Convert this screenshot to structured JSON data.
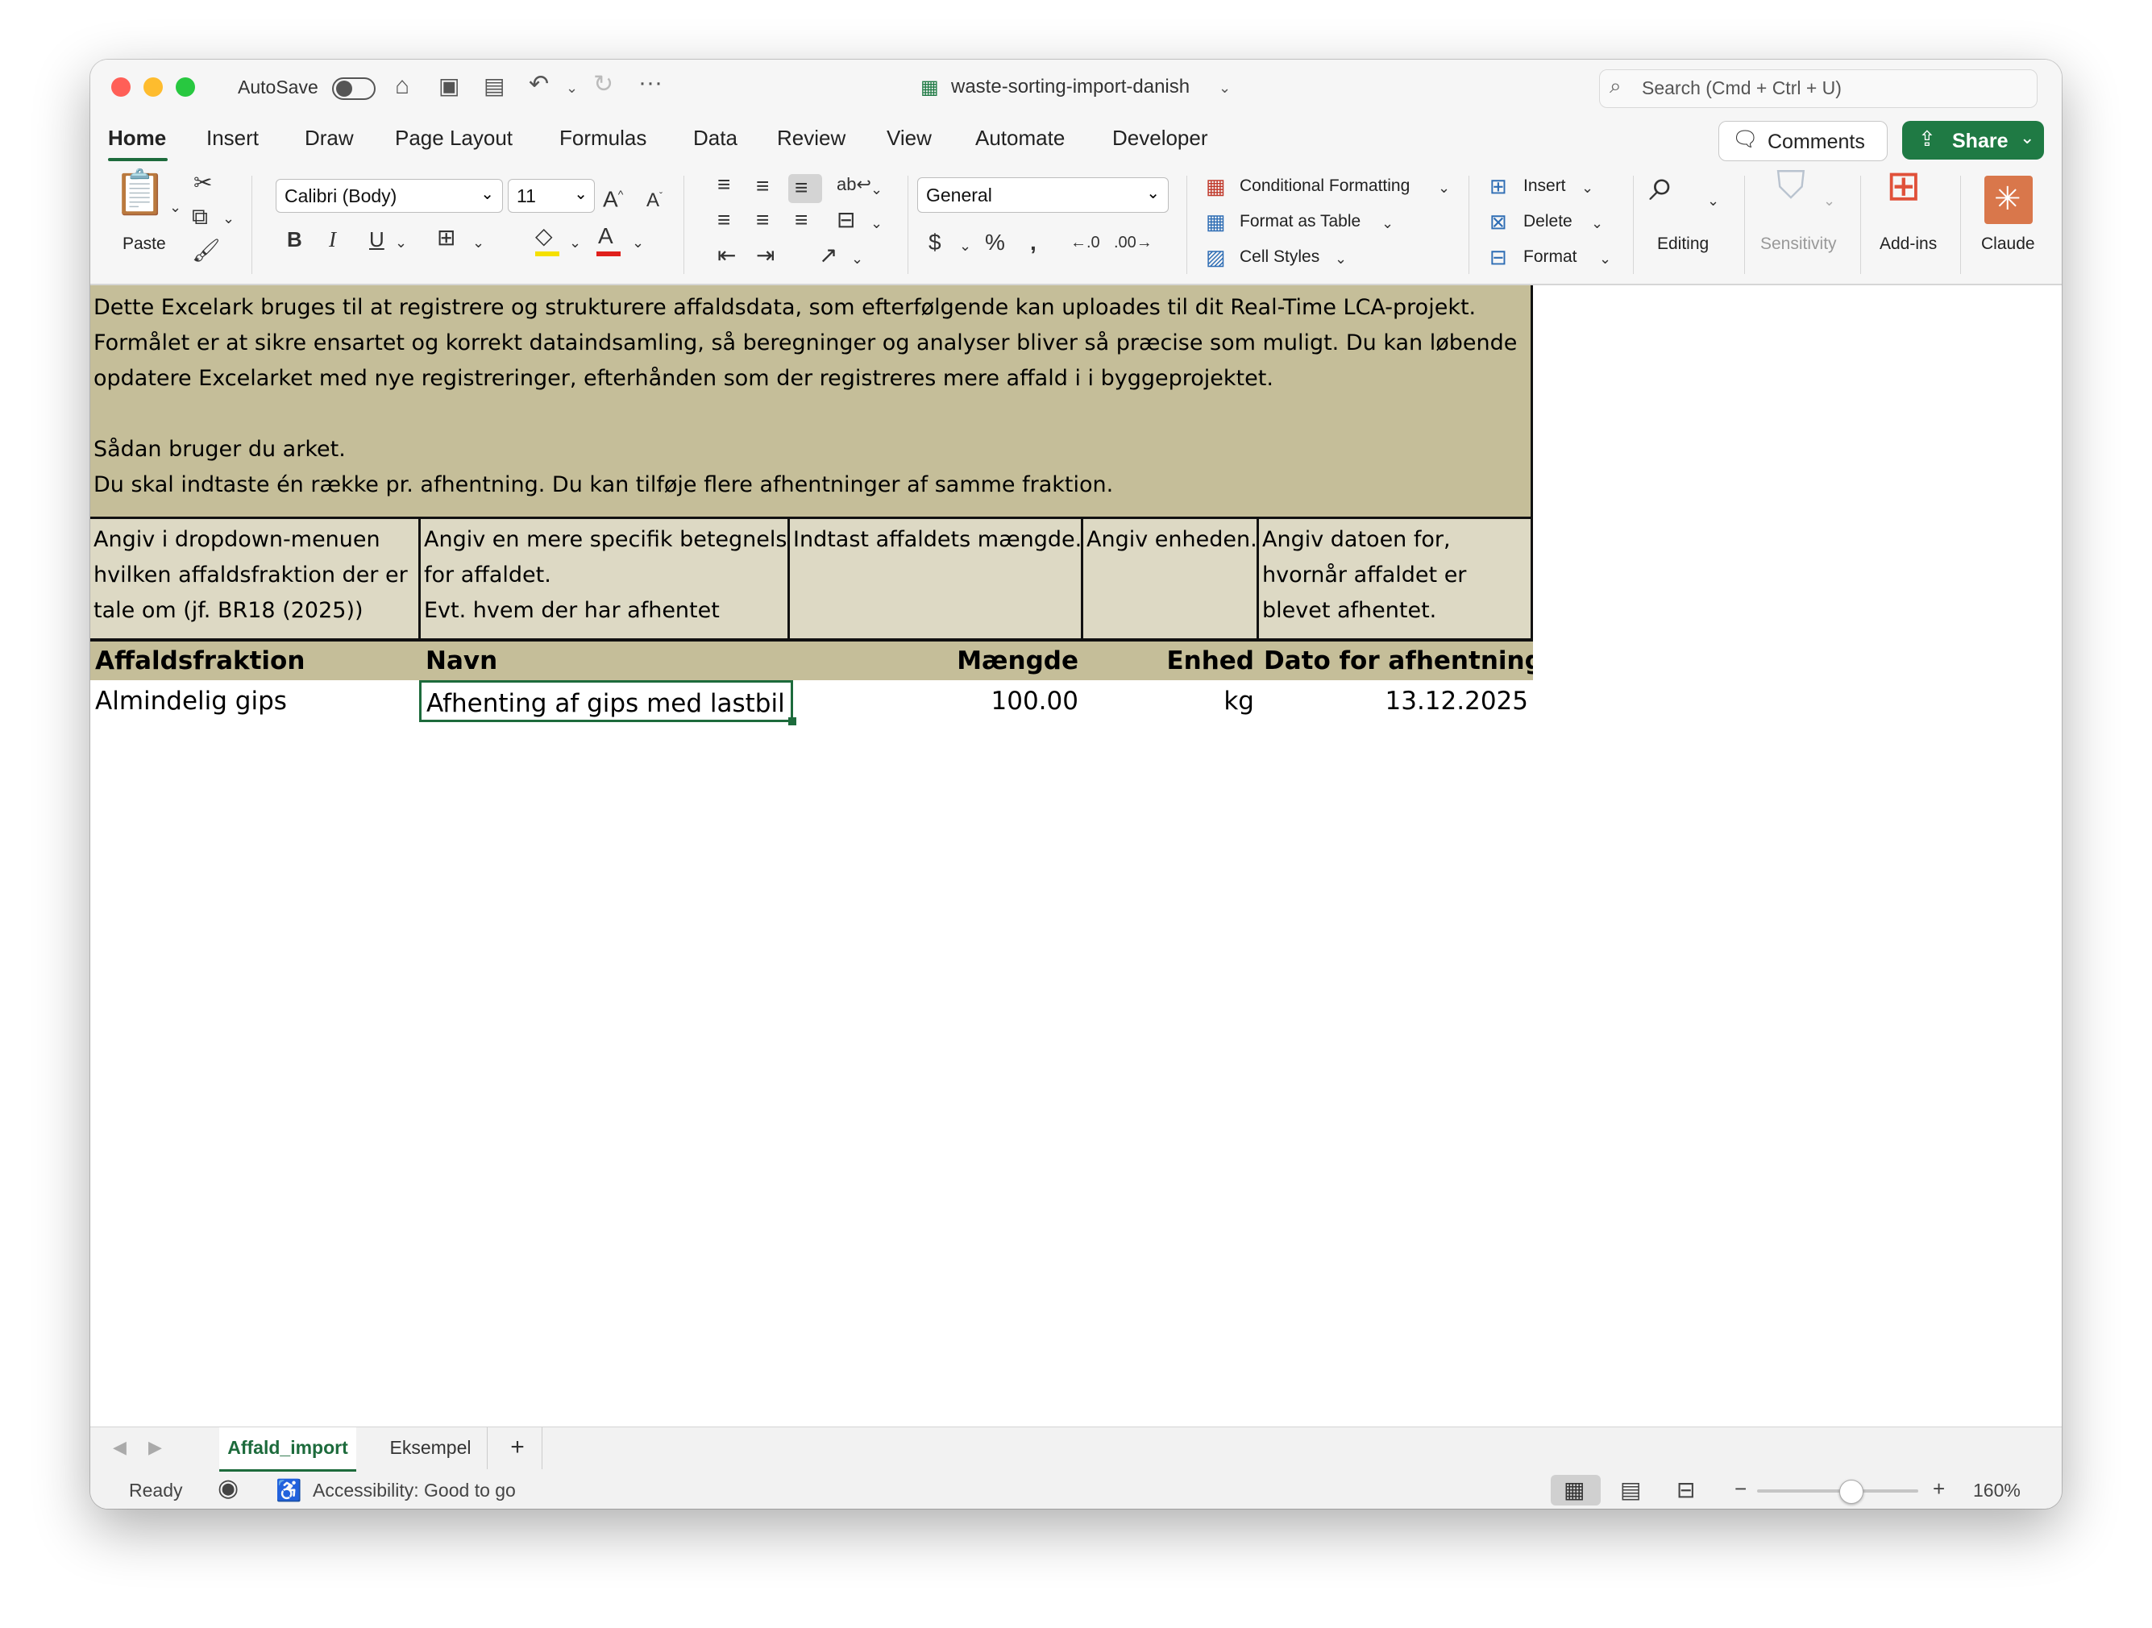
{
  "window": {
    "autosave_label": "AutoSave",
    "file_name": "waste-sorting-import-danish",
    "search_placeholder": "Search (Cmd + Ctrl + U)"
  },
  "tabs": [
    "Home",
    "Insert",
    "Draw",
    "Page Layout",
    "Formulas",
    "Data",
    "Review",
    "View",
    "Automate",
    "Developer"
  ],
  "active_tab": "Home",
  "actions": {
    "comments": "Comments",
    "share": "Share"
  },
  "ribbon": {
    "paste": "Paste",
    "font_name": "Calibri (Body)",
    "font_size": "11",
    "number_format": "General",
    "conditional_formatting": "Conditional Formatting",
    "format_as_table": "Format as Table",
    "cell_styles": "Cell Styles",
    "insert": "Insert",
    "delete": "Delete",
    "format": "Format",
    "editing": "Editing",
    "sensitivity": "Sensitivity",
    "addins": "Add-ins",
    "claude": "Claude",
    "bold": "B",
    "italic": "I",
    "underline": "U"
  },
  "sheet": {
    "intro_lines": [
      "Dette Excelark bruges til at registrere og strukturere affaldsdata, som efterfølgende kan uploades til dit Real-Time LCA-projekt.",
      "Formålet er at sikre ensartet og korrekt dataindsamling, så beregninger og analyser bliver så præcise som muligt. Du kan løbende",
      "opdatere Excelarket med nye registreringer, efterhånden som der registreres mere affald i i byggeprojektet.",
      "",
      "Sådan bruger du arket.",
      "Du skal indtaste én række pr. afhentning. Du kan tilføje flere afhentninger af samme fraktion."
    ],
    "instructions": [
      [
        "Angiv i dropdown-menuen",
        "hvilken affaldsfraktion der er",
        "tale om (jf. BR18 (2025))"
      ],
      [
        "Angiv en mere specifik betegnelse",
        "for affaldet.",
        "Evt. hvem der har afhentet"
      ],
      [
        "Indtast affaldets mængde."
      ],
      [
        "Angiv enheden."
      ],
      [
        "Angiv datoen for,",
        "hvornår affaldet er",
        "blevet afhentet."
      ]
    ],
    "headers": [
      "Affaldsfraktion",
      "Navn",
      "Mængde",
      "Enhed",
      "Dato for afhentning"
    ],
    "rows": [
      [
        "Almindelig gips",
        "Afhenting af gips med lastbil",
        "100.00",
        "kg",
        "13.12.2025"
      ]
    ]
  },
  "sheet_tabs": [
    "Affald_import",
    "Eksempel"
  ],
  "active_sheet": "Affald_import",
  "status": {
    "ready": "Ready",
    "accessibility": "Accessibility: Good to go",
    "zoom": "160%"
  },
  "colors": {
    "accent_green": "#1f7a44",
    "intro_fill": "#c5be99",
    "instruction_fill": "#ddd9c4"
  }
}
